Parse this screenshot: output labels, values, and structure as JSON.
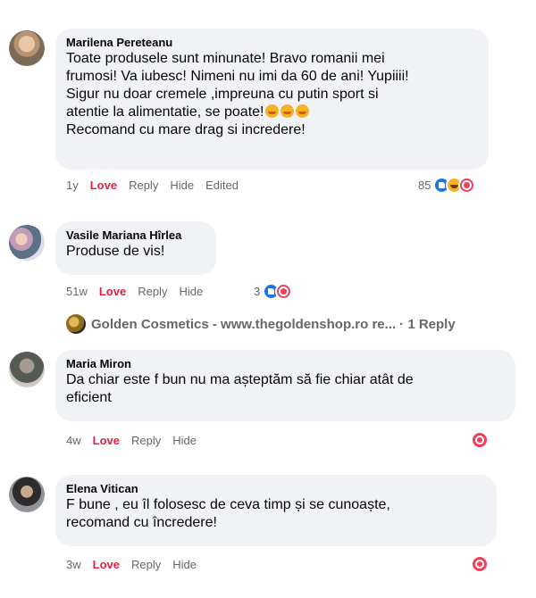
{
  "comments": [
    {
      "author": "Marilena Pereteanu",
      "text_before_emoji": "Toate produsele sunt minunate! Bravo romanii mei\nfrumosi! Va iubesc! Nimeni nu imi da 60 de ani! Yupiiii!\nSigur nu doar cremele ,impreuna cu putin sport si\natentie la alimentatie, se poate!",
      "text_after_emoji": "Recomand cu mare drag si incredere!",
      "emojis": [
        "smiling-face-with-hearts",
        "smiling-face-with-hearts",
        "smiling-face-with-hearts"
      ],
      "time": "1y",
      "love": "Love",
      "reply": "Reply",
      "hide": "Hide",
      "edited": "Edited",
      "reaction_count": "85",
      "reactions": [
        "like",
        "haha",
        "love"
      ]
    },
    {
      "author": "Vasile Mariana Hîrlea",
      "text": "Produse de vis!",
      "time": "51w",
      "love": "Love",
      "reply": "Reply",
      "hide": "Hide",
      "reaction_count": "3",
      "reactions": [
        "like",
        "love"
      ]
    },
    {
      "author": "Maria Miron",
      "text": "Da chiar este f bun nu ma așteptăm să fie chiar atât de\neficient",
      "time": "4w",
      "love": "Love",
      "reply": "Reply",
      "hide": "Hide",
      "reactions": [
        "love"
      ]
    },
    {
      "author": "Elena Vitican",
      "text": "F bune , eu îl folosesc de ceva timp și se cunoaște,\nrecomand cu încredere!",
      "time": "3w",
      "love": "Love",
      "reply": "Reply",
      "hide": "Hide",
      "reactions": [
        "love"
      ]
    }
  ],
  "page_reply": {
    "name": "Golden Cosmetics - www.thegoldenshop.ro re...",
    "count": "· 1 Reply"
  },
  "colors": {
    "bubble": "#f0f2f5",
    "love_text": "#e41e3f",
    "meta_text": "#65676b",
    "like": "#1b74e4",
    "haha": "#f7b125",
    "love": "#f33e58"
  }
}
